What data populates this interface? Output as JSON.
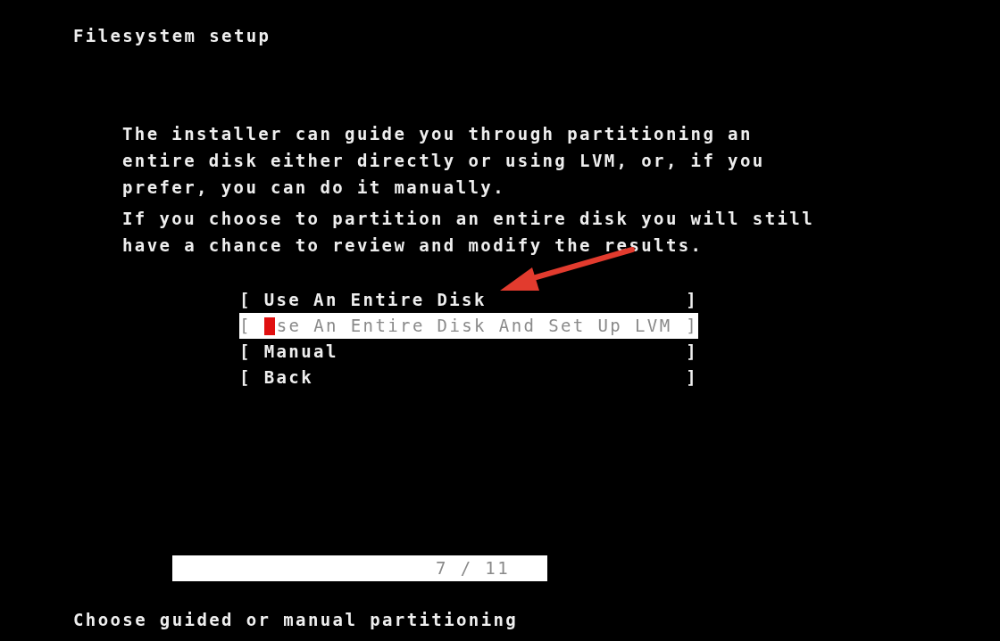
{
  "title": "Filesystem setup",
  "paragraphs": [
    [
      "The installer can guide you through partitioning an",
      "entire disk either directly or using LVM, or, if you",
      "prefer, you can do it manually."
    ],
    [
      "If you choose to partition an entire disk you will still",
      "have a chance to review and modify the results."
    ]
  ],
  "menu": [
    {
      "prefix": "[",
      "label": "Use An Entire Disk",
      "suffix": "]",
      "selected": false,
      "cursor": false
    },
    {
      "prefix": "[",
      "label": "se An Entire Disk And Set Up LVM",
      "suffix": "]",
      "selected": true,
      "cursor": true
    },
    {
      "prefix": "[",
      "label": "Manual",
      "suffix": "]",
      "selected": false,
      "cursor": false
    },
    {
      "prefix": "[",
      "label": "Back",
      "suffix": "]",
      "selected": false,
      "cursor": false
    }
  ],
  "progress": {
    "text": "7 / 11",
    "level": 1
  },
  "status_line": "Choose guided or manual partitioning"
}
